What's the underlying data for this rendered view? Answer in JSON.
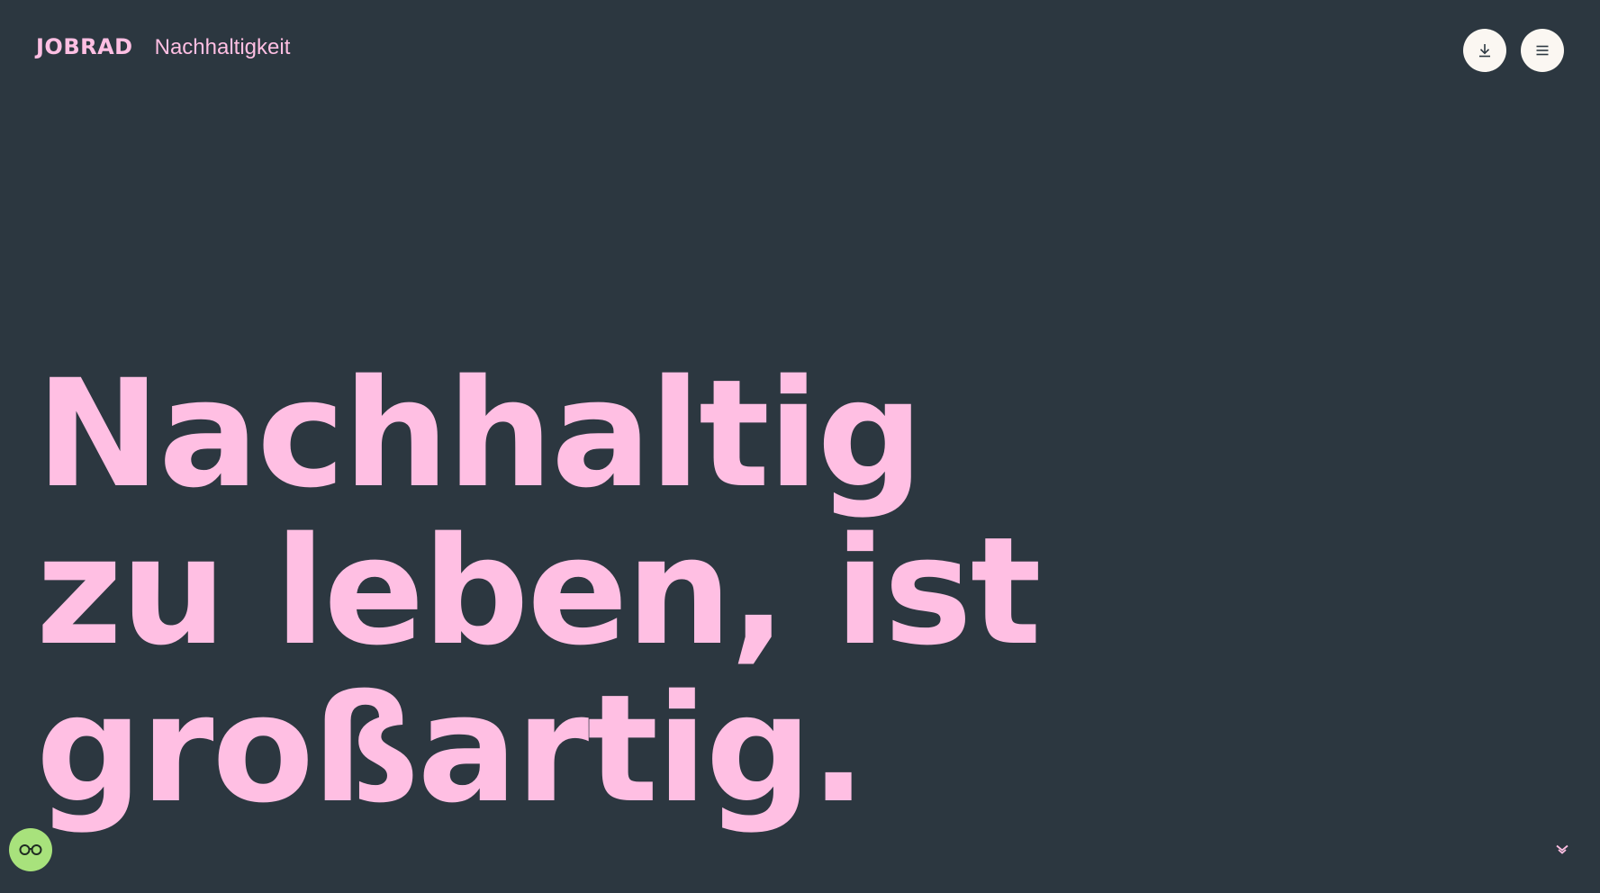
{
  "header": {
    "logo": "JOBRAD",
    "subtitle": "Nachhaltigkeit",
    "download_button_icon": "download-icon",
    "menu_button_icon": "menu-icon"
  },
  "hero": {
    "lines": [
      "Nachhaltig",
      "zu leben, ist",
      "großartig."
    ]
  },
  "scroll_cue": {
    "icon": "chevron-down-icon"
  },
  "accessibility_button": {
    "icon": "glasses-icon"
  },
  "colors": {
    "background": "#2c3740",
    "accent_pink": "#ffbfe3",
    "button_light": "#fbf7f2",
    "accessibility_green": "#a8e27c"
  }
}
